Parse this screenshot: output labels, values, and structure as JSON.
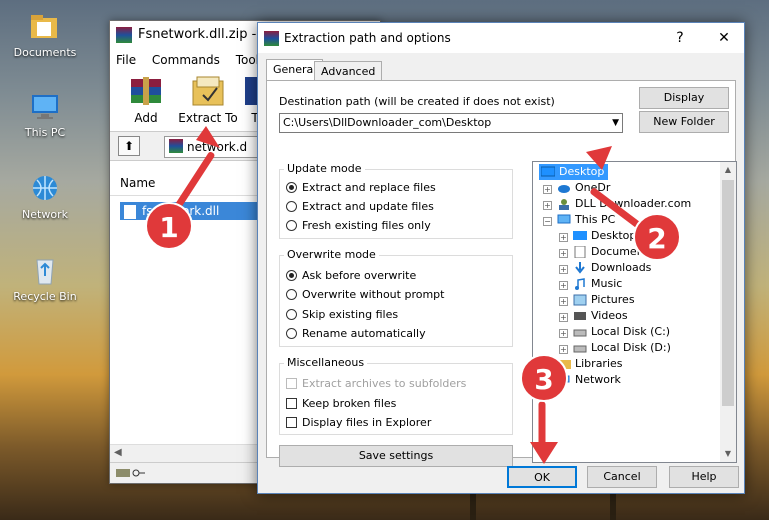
{
  "desktop": {
    "icons": [
      {
        "label": "Documents",
        "icon": "folder-icon"
      },
      {
        "label": "This PC",
        "icon": "computer-icon"
      },
      {
        "label": "Network",
        "icon": "network-icon"
      },
      {
        "label": "Recycle Bin",
        "icon": "recycle-bin-icon"
      }
    ]
  },
  "winrar": {
    "title": "Fsnetwork.dll.zip - W",
    "menu": [
      "File",
      "Commands",
      "Tools"
    ],
    "toolbar": {
      "add": "Add",
      "extract_to": "Extract To",
      "t": "T"
    },
    "path": "network.d",
    "column_name": "Name",
    "file": "fsnetwork.dll"
  },
  "dialog": {
    "title": "Extraction path and options",
    "help_glyph": "?",
    "close_glyph": "✕",
    "tabs": [
      "General",
      "Advanced"
    ],
    "dest_label": "Destination path (will be created if does not exist)",
    "dest_value": "C:\\Users\\DllDownloader_com\\Desktop",
    "display_button": "Display",
    "new_folder_button": "New Folder",
    "update_mode": {
      "title": "Update mode",
      "options": [
        "Extract and replace files",
        "Extract and update files",
        "Fresh existing files only"
      ],
      "selected": 0
    },
    "overwrite_mode": {
      "title": "Overwrite mode",
      "options": [
        "Ask before overwrite",
        "Overwrite without prompt",
        "Skip existing files",
        "Rename automatically"
      ],
      "selected": 0
    },
    "misc": {
      "title": "Miscellaneous",
      "options": [
        "Extract archives to subfolders",
        "Keep broken files",
        "Display files in Explorer"
      ]
    },
    "save_settings": "Save settings",
    "tree": [
      {
        "label": "Desktop",
        "selected": true
      },
      {
        "label": "OneDr"
      },
      {
        "label": "DLL Downloader.com"
      },
      {
        "label": "This PC"
      },
      {
        "label": "Desktop"
      },
      {
        "label": "Documents"
      },
      {
        "label": "Downloads"
      },
      {
        "label": "Music"
      },
      {
        "label": "Pictures"
      },
      {
        "label": "Videos"
      },
      {
        "label": "Local Disk (C:)"
      },
      {
        "label": "Local Disk (D:)"
      },
      {
        "label": "Libraries"
      },
      {
        "label": "Network"
      }
    ],
    "ok": "OK",
    "cancel": "Cancel",
    "help": "Help"
  },
  "steps": [
    "1",
    "2",
    "3"
  ],
  "colors": {
    "accent": "#0078d7",
    "selection": "#3399ff",
    "annotation": "#e0393a"
  }
}
